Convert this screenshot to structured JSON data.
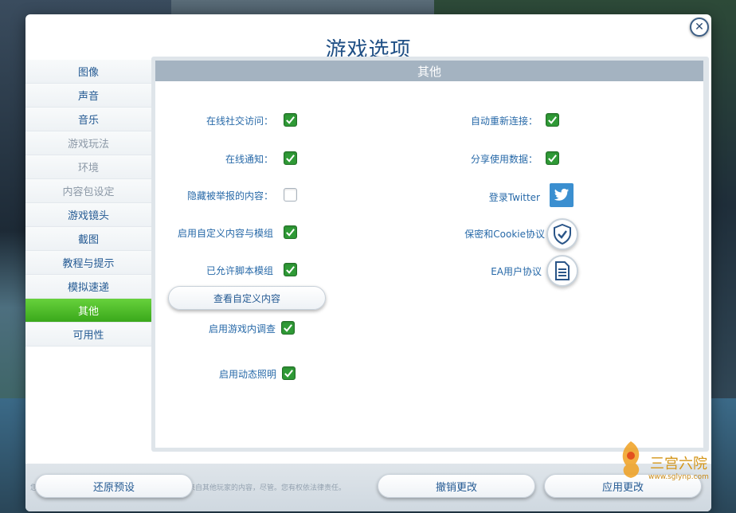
{
  "dialog": {
    "title": "游戏选项"
  },
  "sidebar": {
    "items": [
      {
        "label": "图像",
        "state": "normal"
      },
      {
        "label": "声音",
        "state": "normal"
      },
      {
        "label": "音乐",
        "state": "normal"
      },
      {
        "label": "游戏玩法",
        "state": "disabled"
      },
      {
        "label": "环境",
        "state": "disabled"
      },
      {
        "label": "内容包设定",
        "state": "disabled"
      },
      {
        "label": "游戏镜头",
        "state": "normal"
      },
      {
        "label": "截图",
        "state": "normal"
      },
      {
        "label": "教程与提示",
        "state": "normal"
      },
      {
        "label": "模拟速递",
        "state": "normal"
      },
      {
        "label": "其他",
        "state": "active"
      },
      {
        "label": "可用性",
        "state": "normal"
      }
    ]
  },
  "panel": {
    "header": "其他",
    "left_options": [
      {
        "label": "在线社交访问：",
        "checked": true
      },
      {
        "label": "在线通知：",
        "checked": true
      },
      {
        "label": "隐藏被举报的内容：",
        "checked": false
      },
      {
        "label": "启用自定义内容与模组",
        "checked": true
      },
      {
        "label": "已允许脚本模组",
        "checked": true
      }
    ],
    "view_custom_content_button": "查看自定义内容",
    "lower_options": [
      {
        "label": "启用游戏内调查",
        "checked": true
      },
      {
        "label": "启用动态照明",
        "checked": true
      }
    ],
    "right_options": [
      {
        "label": "自动重新连接：",
        "checked": true
      },
      {
        "label": "分享使用数据：",
        "checked": true
      }
    ],
    "links": {
      "twitter_label": "登录Twitter",
      "privacy_label": "保密和Cookie协议",
      "eula_label": "EA用户协议"
    }
  },
  "footer": {
    "restore_defaults": "还原预设",
    "cancel_changes": "撤销更改",
    "apply_changes": "应用更改",
    "note": "您的在线游戏数据将被隐藏或删除。您可能会看到来自其他玩家的内容，尽管。您有权依法律责任。"
  },
  "watermark": {
    "text": "三宫六院",
    "url": "www.sglynp.com"
  },
  "colors": {
    "accent_blue": "#245a93",
    "active_green": "#3aa81b",
    "check_green": "#2f9a36",
    "twitter_blue": "#3b8fd0"
  }
}
